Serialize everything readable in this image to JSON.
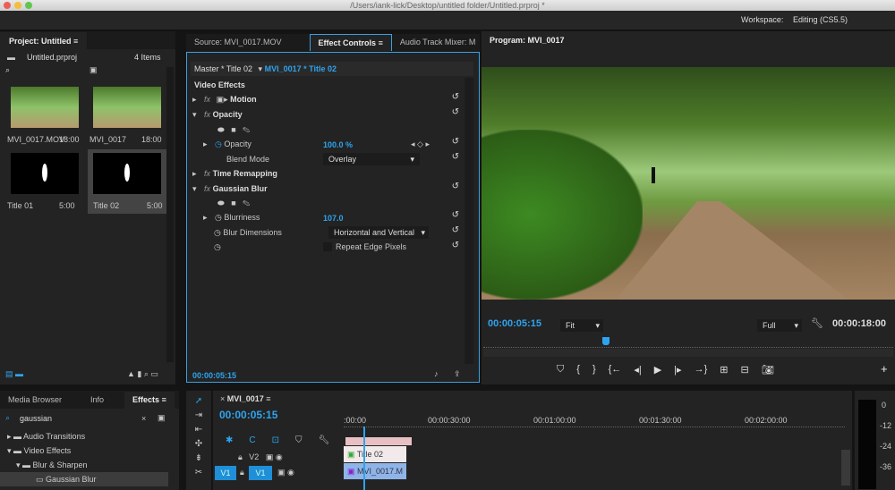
{
  "window": {
    "path": "/Users/iank-lick/Desktop/untitled folder/Untitled.prproj *"
  },
  "workspace": {
    "label": "Workspace:",
    "value": "Editing (CS5.5)"
  },
  "project": {
    "tab": "Project: Untitled",
    "file": "Untitled.prproj",
    "count": "4 Items",
    "items": [
      {
        "name": "MVI_0017.MOV",
        "dur": "18:00"
      },
      {
        "name": "MVI_0017",
        "dur": "18:00"
      },
      {
        "name": "Title 01",
        "dur": "5:00"
      },
      {
        "name": "Title 02",
        "dur": "5:00"
      }
    ]
  },
  "center_tabs": [
    "Source: MVI_0017.MOV",
    "Effect Controls",
    "Audio Track Mixer: M"
  ],
  "effect_controls": {
    "master": "Master * Title 02",
    "clip": "MVI_0017 * Title 02",
    "section": "Video Effects",
    "motion": "Motion",
    "opacity": "Opacity",
    "opacity_param": "Opacity",
    "opacity_value": "100.0 %",
    "blend_label": "Blend Mode",
    "blend_value": "Overlay",
    "time_remap": "Time Remapping",
    "gaussian": "Gaussian Blur",
    "blurriness": "Blurriness",
    "blurriness_value": "107.0",
    "blur_dim": "Blur Dimensions",
    "blur_dim_value": "Horizontal and Vertical",
    "repeat": "Repeat Edge Pixels",
    "fx": "fx",
    "timecode": "00:00:05:15"
  },
  "program": {
    "tab": "Program: MVI_0017",
    "timecode": "00:00:05:15",
    "fit": "Fit",
    "quality": "Full",
    "duration": "00:00:18:00",
    "playhead_fraction": 0.29
  },
  "effects_panel": {
    "tabs": [
      "Media Browser",
      "Info",
      "Effects"
    ],
    "search": "gaussian",
    "tree": [
      "Audio Transitions",
      "Video Effects",
      "Blur & Sharpen",
      "Gaussian Blur"
    ]
  },
  "timeline": {
    "tab": "MVI_0017",
    "timecode": "00:00:05:15",
    "ruler": [
      ":00:00",
      "00:00:30:00",
      "00:01:00:00",
      "00:01:30:00",
      "00:02:00:00"
    ],
    "tracks": [
      {
        "name": "V2",
        "clip": "Title 02"
      },
      {
        "name": "V1",
        "src": "V1",
        "clip": "MVI_0017.M"
      }
    ]
  },
  "meter": {
    "labels": [
      "0",
      "-12",
      "-24",
      "-36"
    ]
  }
}
